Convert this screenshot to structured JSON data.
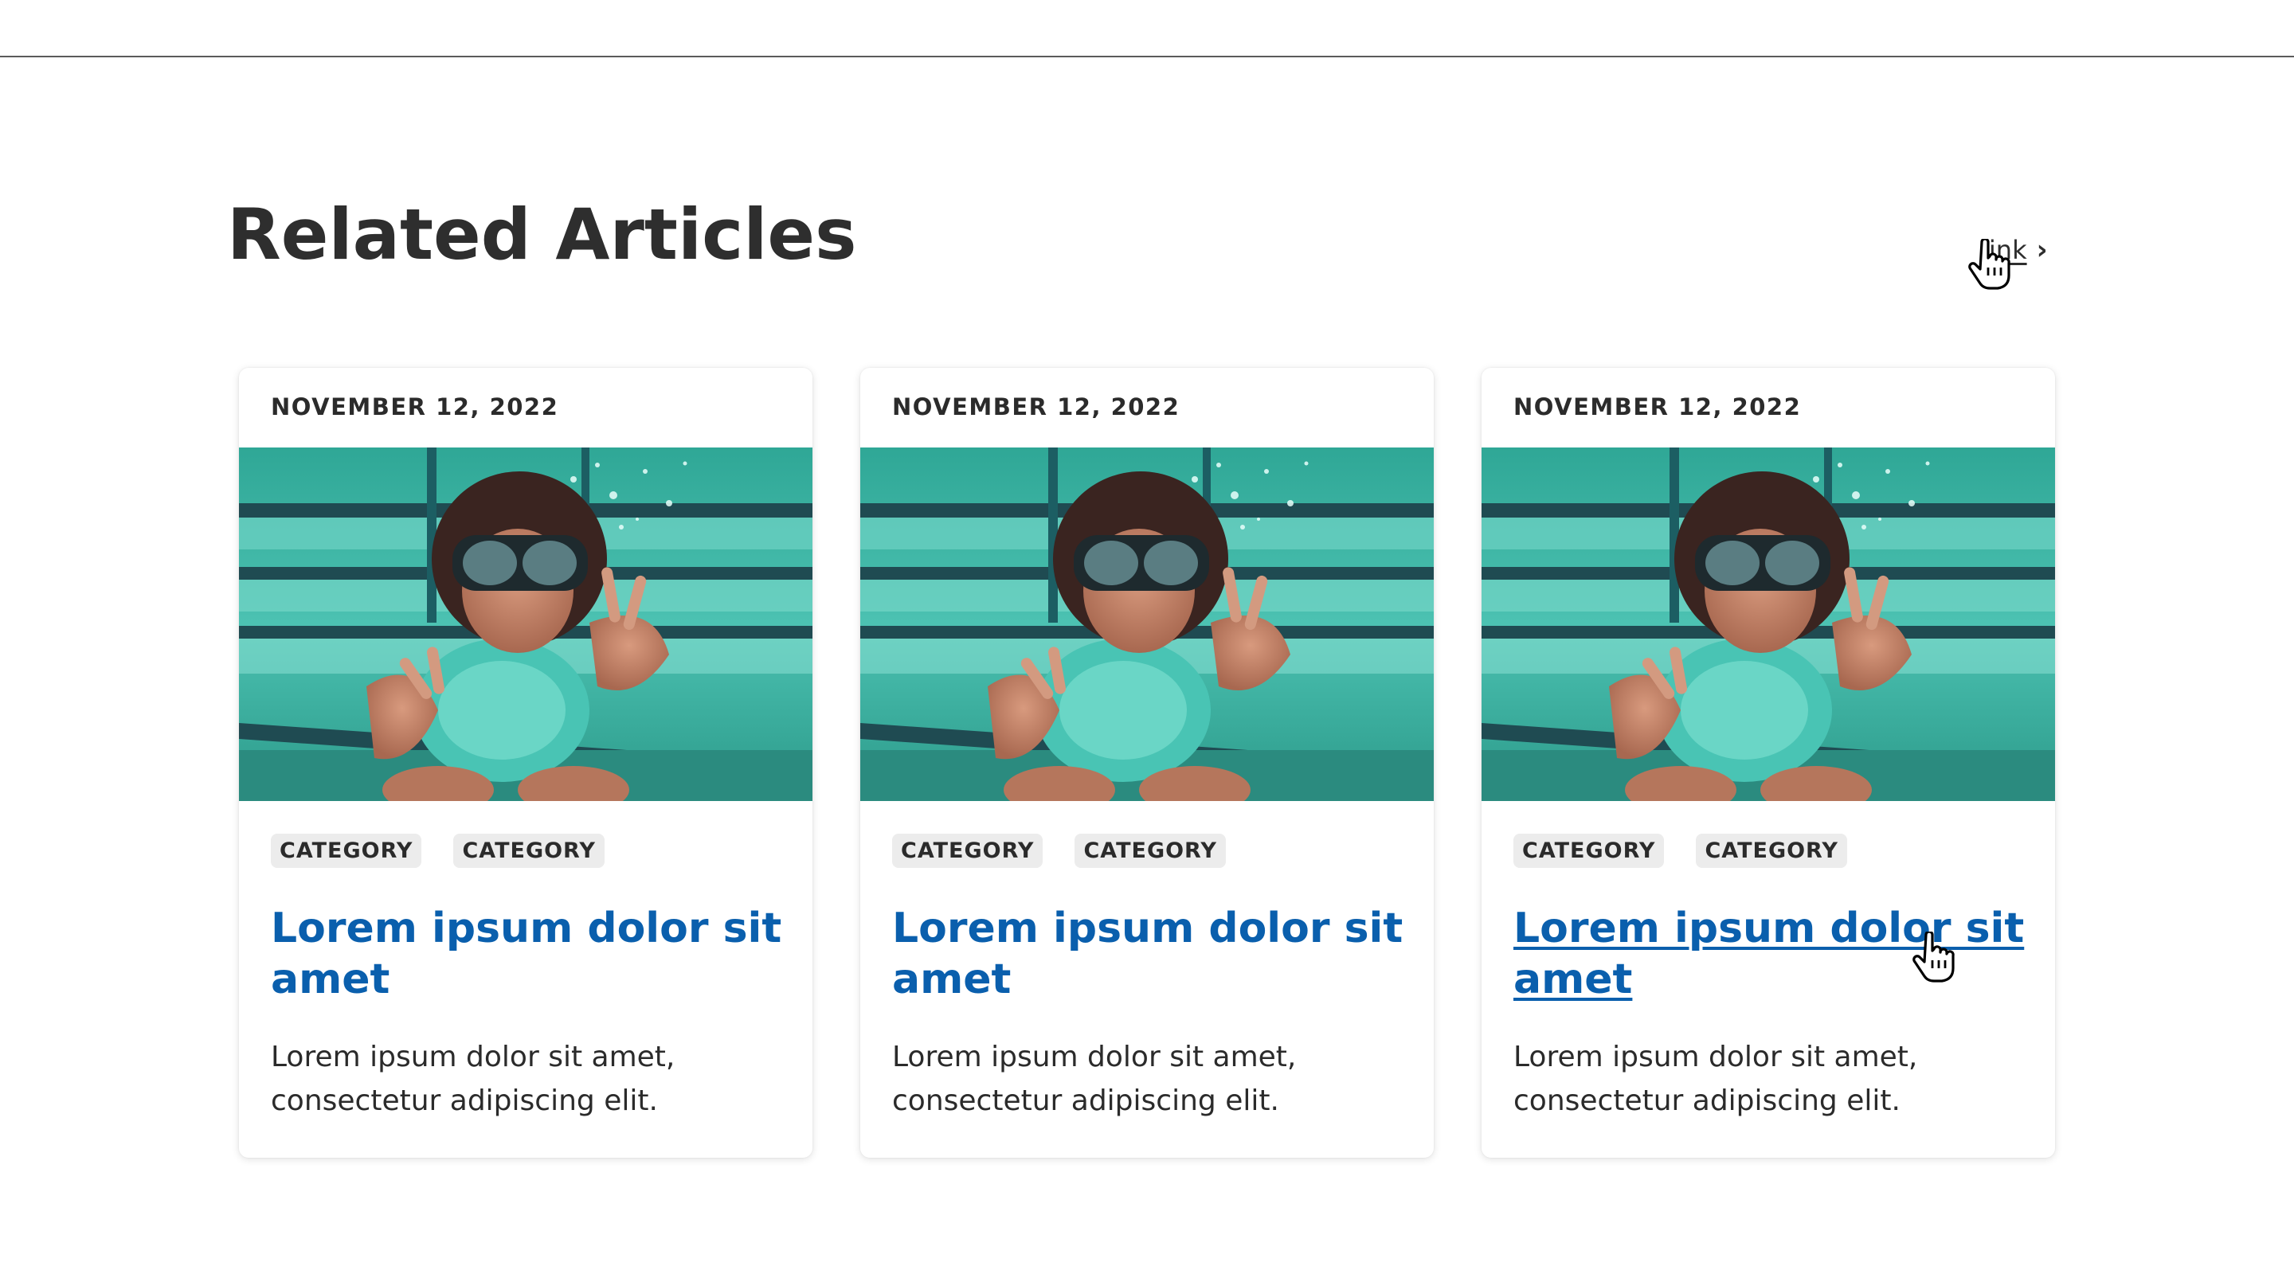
{
  "section": {
    "title": "Related Articles",
    "link_label": "link",
    "link_chevron": "›"
  },
  "cards": [
    {
      "date": "NOVEMBER 12, 2022",
      "image_alt": "Girl with snorkel mask making peace signs underwater in a pool",
      "tags": [
        "CATEGORY",
        "CATEGORY"
      ],
      "title": "Lorem ipsum dolor sit amet",
      "body": "Lorem ipsum dolor sit amet, consectetur adipiscing elit."
    },
    {
      "date": "NOVEMBER 12, 2022",
      "image_alt": "Girl with snorkel mask making peace signs underwater in a pool",
      "tags": [
        "CATEGORY",
        "CATEGORY"
      ],
      "title": "Lorem ipsum dolor sit amet",
      "body": "Lorem ipsum dolor sit amet, consectetur adipiscing elit."
    },
    {
      "date": "NOVEMBER 12, 2022",
      "image_alt": "Girl with snorkel mask making peace signs underwater in a pool",
      "tags": [
        "CATEGORY",
        "CATEGORY"
      ],
      "title": "Lorem ipsum dolor sit amet",
      "body": "Lorem ipsum dolor sit amet, consectetur adipiscing elit."
    }
  ],
  "colors": {
    "title_link": "#0a5fad",
    "text": "#2b2b2b",
    "tag_bg": "#ececec",
    "pool_water": "#3fb8a8"
  },
  "icons": {
    "link_chevron": "chevron-right-icon",
    "cursor": "hand-pointer-icon"
  }
}
